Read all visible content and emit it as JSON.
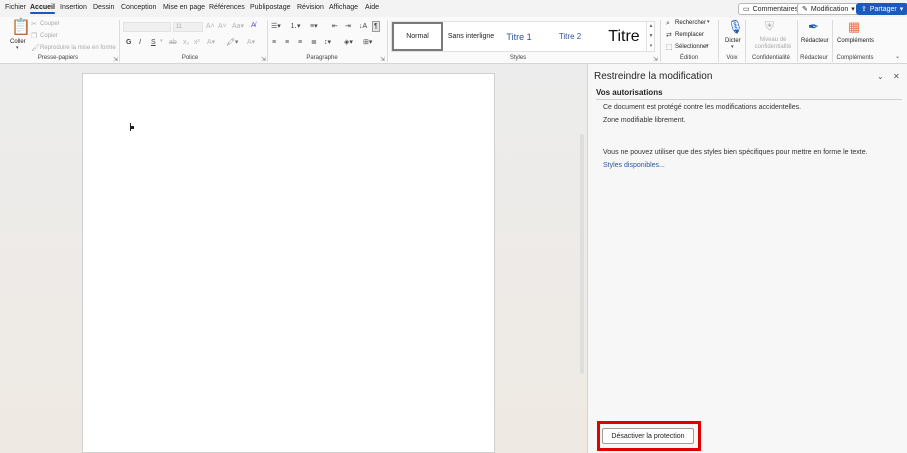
{
  "tabs": [
    "Fichier",
    "Accueil",
    "Insertion",
    "Dessin",
    "Conception",
    "Mise en page",
    "Références",
    "Publipostage",
    "Révision",
    "Affichage",
    "Aide"
  ],
  "active_tab": "Accueil",
  "top_right": {
    "comments": "Commentaires",
    "editing": "Modification",
    "share": "Partager"
  },
  "clipboard": {
    "paste": "Coller",
    "cut": "Couper",
    "copy": "Copier",
    "format_painter": "Reproduire la mise en forme",
    "label": "Presse-papiers"
  },
  "font": {
    "label": "Police",
    "bold": "G",
    "italic": "I",
    "underline": "S",
    "font_size": "11"
  },
  "paragraph": {
    "label": "Paragraphe"
  },
  "styles": {
    "label": "Styles",
    "items": [
      "Normal",
      "Sans interligne",
      "Titre 1",
      "Titre 2",
      "Titre"
    ],
    "selected": "Normal"
  },
  "editing": {
    "label": "Édition",
    "find": "Rechercher",
    "replace": "Remplacer",
    "select": "Sélectionner"
  },
  "voice": {
    "dictate": "Dicter",
    "label": "Voix"
  },
  "sensitivity": {
    "level": "Niveau de confidentialité",
    "label": "Confidentialité"
  },
  "editor": {
    "name": "Rédacteur",
    "label": "Rédacteur"
  },
  "addins": {
    "name": "Compléments",
    "label": "Compléments"
  },
  "pane": {
    "title": "Restreindre la modification",
    "section": "Vos autorisations",
    "line1": "Ce document est protégé contre les modifications accidentelles.",
    "line2": "Zone modifiable librement.",
    "line3": "Vous ne pouvez utiliser que des styles bien spécifiques pour mettre en forme le texte.",
    "styles_link": "Styles disponibles...",
    "stop_button": "Désactiver la protection"
  },
  "colors": {
    "accent": "#185abd",
    "highlight": "#e00000",
    "link": "#2b579a"
  }
}
